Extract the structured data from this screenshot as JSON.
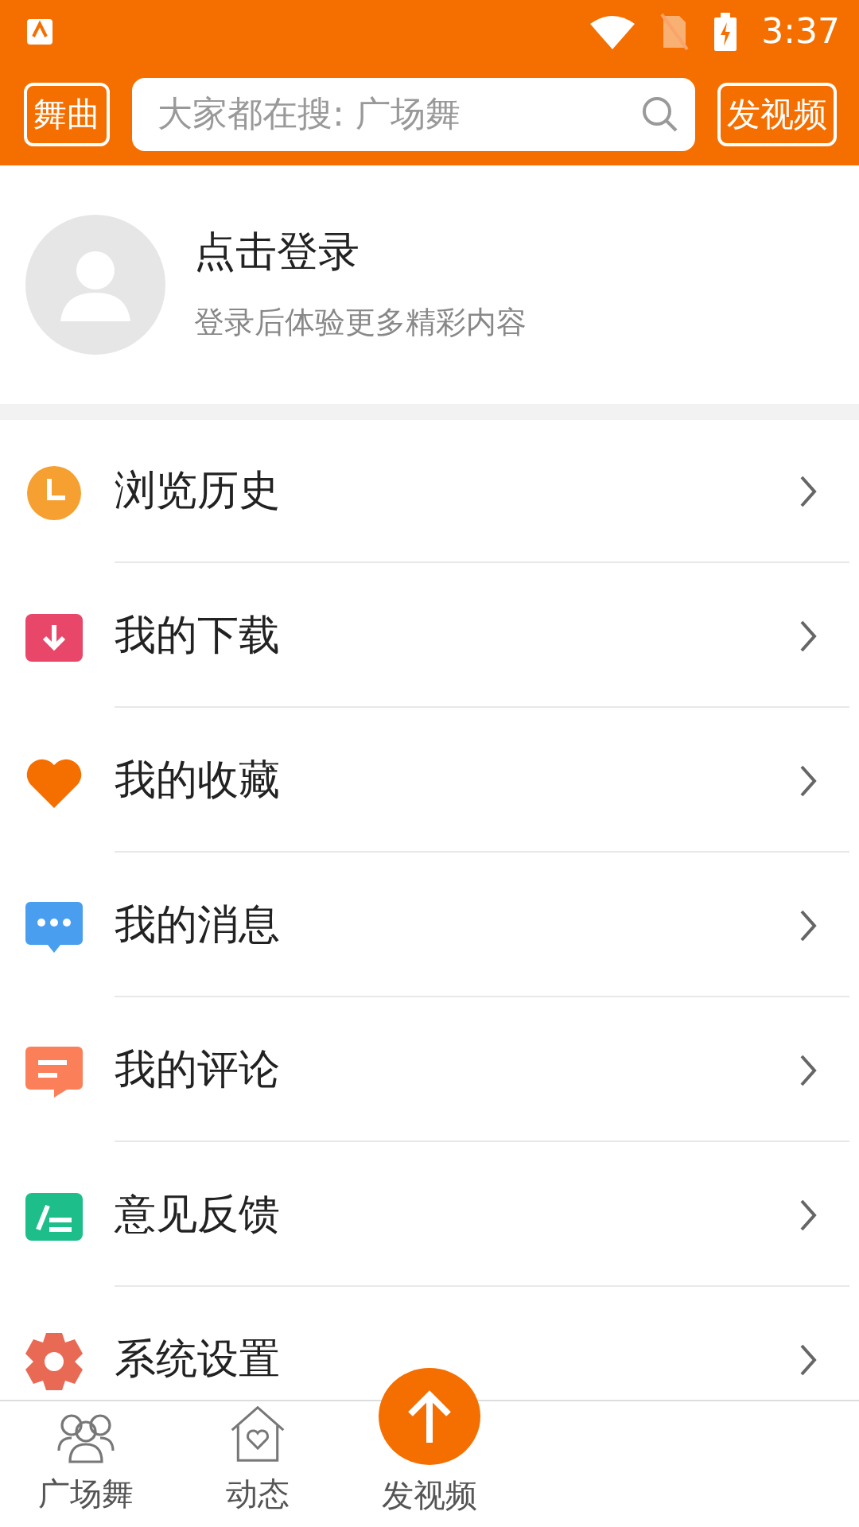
{
  "status_bar": {
    "time": "3:37"
  },
  "header": {
    "left_button": "舞曲",
    "search": {
      "placeholder": "大家都在搜: 广场舞"
    },
    "right_button": "发视频"
  },
  "profile": {
    "title": "点击登录",
    "subtitle": "登录后体验更多精彩内容"
  },
  "menu": [
    {
      "label": "浏览历史",
      "kind": "clock",
      "color": "#f5a030"
    },
    {
      "label": "我的下载",
      "kind": "download",
      "color": "#e9476a"
    },
    {
      "label": "我的收藏",
      "kind": "heart",
      "color": "#f56f00"
    },
    {
      "label": "我的消息",
      "kind": "message",
      "color": "#4a9ef0"
    },
    {
      "label": "我的评论",
      "kind": "comment",
      "color": "#fb805a"
    },
    {
      "label": "意见反馈",
      "kind": "feedback",
      "color": "#1dbe8a"
    },
    {
      "label": "系统设置",
      "kind": "gear",
      "color": "#e86a55"
    }
  ],
  "bottom_nav": [
    {
      "label": "广场舞",
      "kind": "people",
      "selected": false
    },
    {
      "label": "动态",
      "kind": "home",
      "selected": false
    },
    {
      "label": "发视频",
      "kind": "upload",
      "selected": false
    }
  ]
}
